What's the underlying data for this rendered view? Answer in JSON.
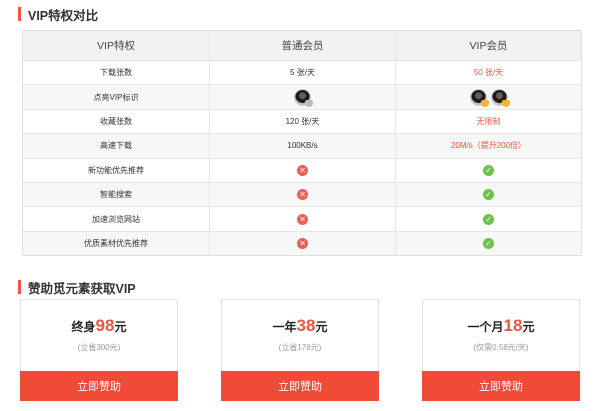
{
  "section1": {
    "title": "VIP特权对比"
  },
  "table": {
    "headers": [
      "VIP特权",
      "普通会员",
      "VIP会员"
    ],
    "rows": [
      {
        "feature": "下载张数",
        "normal": "5 张/天",
        "vip": "50 张/天"
      },
      {
        "feature": "点亮VIP标识",
        "normal_icon": "avatar",
        "vip_icon": "avatar-pair"
      },
      {
        "feature": "收藏张数",
        "normal": "120 张/天",
        "vip": "无限制"
      },
      {
        "feature": "高速下载",
        "normal": "100KB/s",
        "vip": "20M/s（提升200倍）"
      },
      {
        "feature": "新功能优先推荐",
        "normal_icon": "x",
        "vip_icon": "check"
      },
      {
        "feature": "智能搜索",
        "normal_icon": "x",
        "vip_icon": "check"
      },
      {
        "feature": "加速浏览网站",
        "normal_icon": "x",
        "vip_icon": "check"
      },
      {
        "feature": "优质素材优先推荐",
        "normal_icon": "x",
        "vip_icon": "check"
      }
    ]
  },
  "section2": {
    "title": "赞助觅元素获取VIP"
  },
  "plans": [
    {
      "prefix": "终身",
      "price": "98",
      "unit": "元",
      "note": "(立省300元)",
      "button": "立即赞助"
    },
    {
      "prefix": "一年",
      "price": "38",
      "unit": "元",
      "note": "(立省178元)",
      "button": "立即赞助"
    },
    {
      "prefix": "一个月",
      "price": "18",
      "unit": "元",
      "note": "(仅需0.58元/天)",
      "button": "立即赞助"
    }
  ],
  "colors": {
    "accent": "#f04b36",
    "price": "#e8573f",
    "check": "#6cc24a",
    "cross": "#ee5e55"
  }
}
